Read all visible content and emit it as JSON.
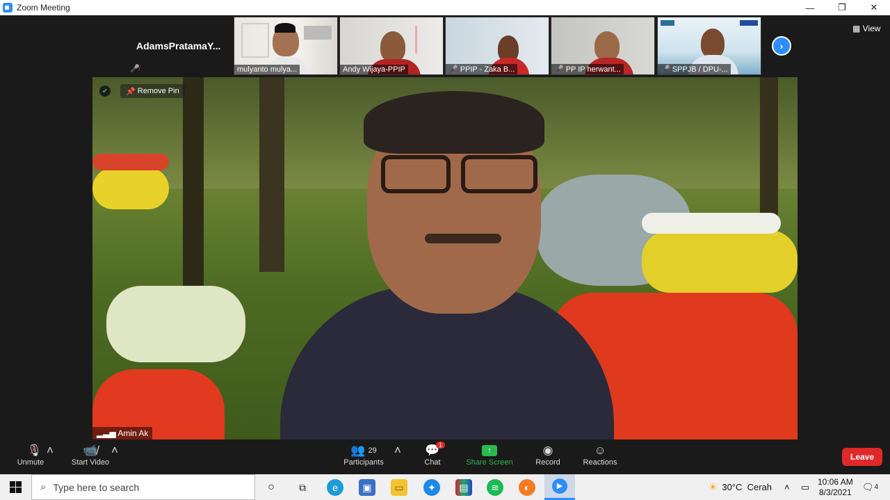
{
  "window": {
    "title": "Zoom Meeting",
    "minimize": "—",
    "restore": "❐",
    "close": "✕"
  },
  "self_tile": {
    "name": "AdamsPratamaY..."
  },
  "thumbnails": [
    {
      "name": "mulyanto mulya...",
      "muted": false
    },
    {
      "name": "Andy Wijaya-PPIP",
      "muted": false
    },
    {
      "name": "PPIP - Zaka B...",
      "muted": true
    },
    {
      "name": "PP IP herwant...",
      "muted": true
    },
    {
      "name": "SPPJB / DPU-...",
      "muted": true
    }
  ],
  "view_label": "View",
  "main": {
    "remove_pin_label": "Remove Pin",
    "speaker_name": "Amin Ak"
  },
  "toolbar": {
    "unmute_label": "Unmute",
    "start_video_label": "Start Video",
    "participants_label": "Participants",
    "participants_count": "29",
    "chat_label": "Chat",
    "chat_badge": "1",
    "share_label": "Share Screen",
    "record_label": "Record",
    "reactions_label": "Reactions",
    "leave_label": "Leave"
  },
  "taskbar": {
    "search_placeholder": "Type here to search",
    "weather": "30°C  Cerah",
    "time": "10:06 AM",
    "date": "8/3/2021",
    "notifications": "4"
  },
  "colors": {
    "accent": "#2d8cff",
    "leave": "#e02828",
    "share": "#2db84d"
  }
}
